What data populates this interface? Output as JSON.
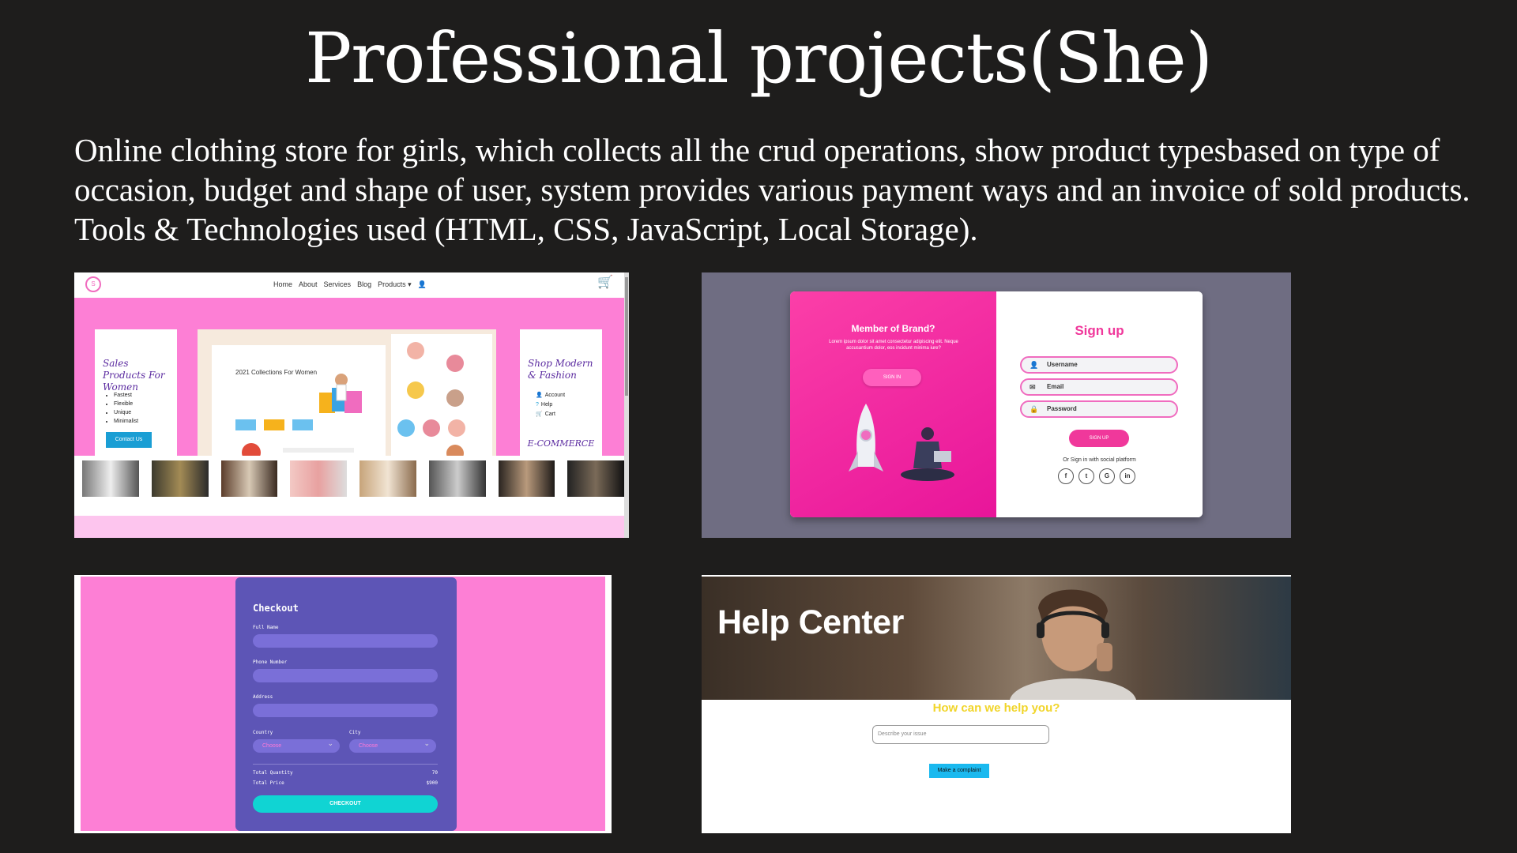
{
  "slide": {
    "title": "Professional projects(She)",
    "description": "Online clothing store for girls, which collects all the crud operations, show product typesbased on type of occasion, budget and shape of user, system provides various payment ways and an invoice of sold products. Tools & Technologies used (HTML, CSS, JavaScript, Local Storage)."
  },
  "store": {
    "logo_text": "S",
    "nav": [
      "Home",
      "About",
      "Services",
      "Blog",
      "Products ▾"
    ],
    "left_card": {
      "title": "Sales Products For Women",
      "bullets": [
        "Fastest",
        "Flexible",
        "Unique",
        "Minimalist"
      ],
      "button": "Contact Us"
    },
    "right_card": {
      "title": "Shop Modern & Fashion",
      "links": [
        "Account",
        "Help",
        "Cart"
      ],
      "tagline": "E-COMMERCE"
    },
    "collage": {
      "heading": "2021 Collections For Women"
    },
    "colors": {
      "pink": "#fd7fd5",
      "accent": "#5b2ba0",
      "button": "#1a9ed4"
    }
  },
  "signup": {
    "left_heading": "Member of Brand?",
    "left_text": "Lorem ipsum dolor sit amet consectetur adipiscing elit. Neque accusantium dolor, eos incidunt minima iure?",
    "signin_button": "SIGN IN",
    "title": "Sign up",
    "fields": [
      {
        "label": "Username",
        "icon": "user-icon"
      },
      {
        "label": "Email",
        "icon": "mail-icon"
      },
      {
        "label": "Password",
        "icon": "lock-icon"
      }
    ],
    "signup_button": "SIGN UP",
    "social_text": "Or Sign in with social platform",
    "socials": [
      {
        "glyph": "f",
        "icon": "facebook-icon"
      },
      {
        "glyph": "t",
        "icon": "twitter-icon"
      },
      {
        "glyph": "G",
        "icon": "google-icon"
      },
      {
        "glyph": "in",
        "icon": "linkedin-icon"
      }
    ]
  },
  "checkout": {
    "title": "Checkout",
    "full_name_label": "Full Name",
    "phone_label": "Phone Number",
    "address_label": "Address",
    "country_label": "Country",
    "city_label": "City",
    "country_value": "Choose",
    "city_value": "Choose",
    "total_quantity_label": "Total Quantity",
    "total_quantity_value": "70",
    "total_price_label": "Total Price",
    "total_price_value": "$900",
    "button": "CHECKOUT"
  },
  "help": {
    "title": "Help Center",
    "question": "How can we help you?",
    "input_placeholder": "Describe your issue",
    "button": "Make a complaint"
  }
}
